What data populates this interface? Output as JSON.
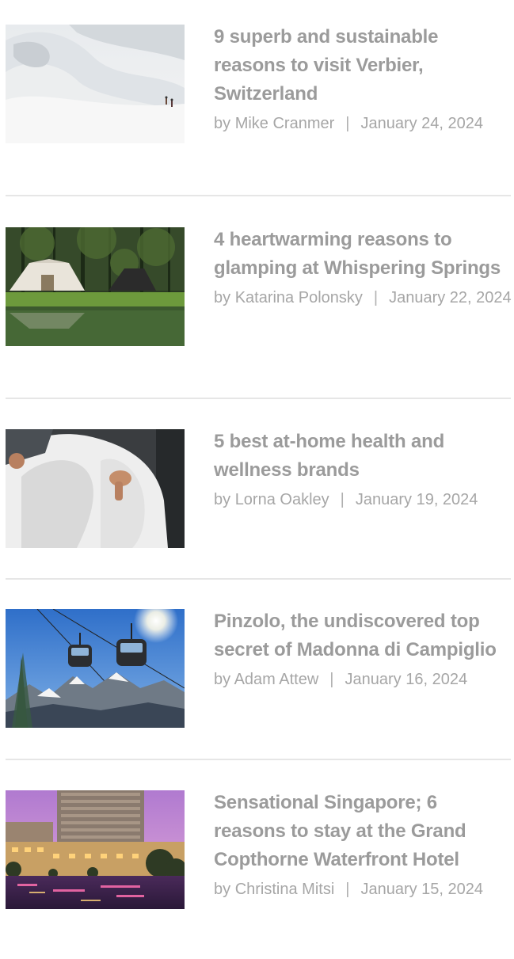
{
  "posts": [
    {
      "title": "9 superb and sustainable reasons to visit Verbier, Switzerland",
      "by": "by",
      "author": "Mike Cranmer",
      "separator": "|",
      "date": "January 24, 2024",
      "image": "ski-slope-image"
    },
    {
      "title": "4 heartwarming reasons to glamping at Whispering Springs",
      "by": "by",
      "author": "Katarina Polonsky",
      "separator": "|",
      "date": "January 22, 2024",
      "image": "glamping-tent-image"
    },
    {
      "title": "5 best at-home health and wellness brands",
      "by": "by",
      "author": "Lorna Oakley",
      "separator": "|",
      "date": "January 19, 2024",
      "image": "bathrobe-meditation-image"
    },
    {
      "title": "Pinzolo, the undiscovered top secret of Madonna di Campiglio",
      "by": "by",
      "author": "Adam Attew",
      "separator": "|",
      "date": "January 16, 2024",
      "image": "cable-car-mountains-image"
    },
    {
      "title": "Sensational Singapore; 6 reasons to stay at the Grand Copthorne Waterfront Hotel",
      "by": "by",
      "author": "Christina Mitsi",
      "separator": "|",
      "date": "January 15, 2024",
      "image": "singapore-hotel-image"
    }
  ],
  "colors": {
    "title": "#9b9b9b",
    "meta": "#a6a6a6",
    "divider": "#e6e6e6"
  }
}
